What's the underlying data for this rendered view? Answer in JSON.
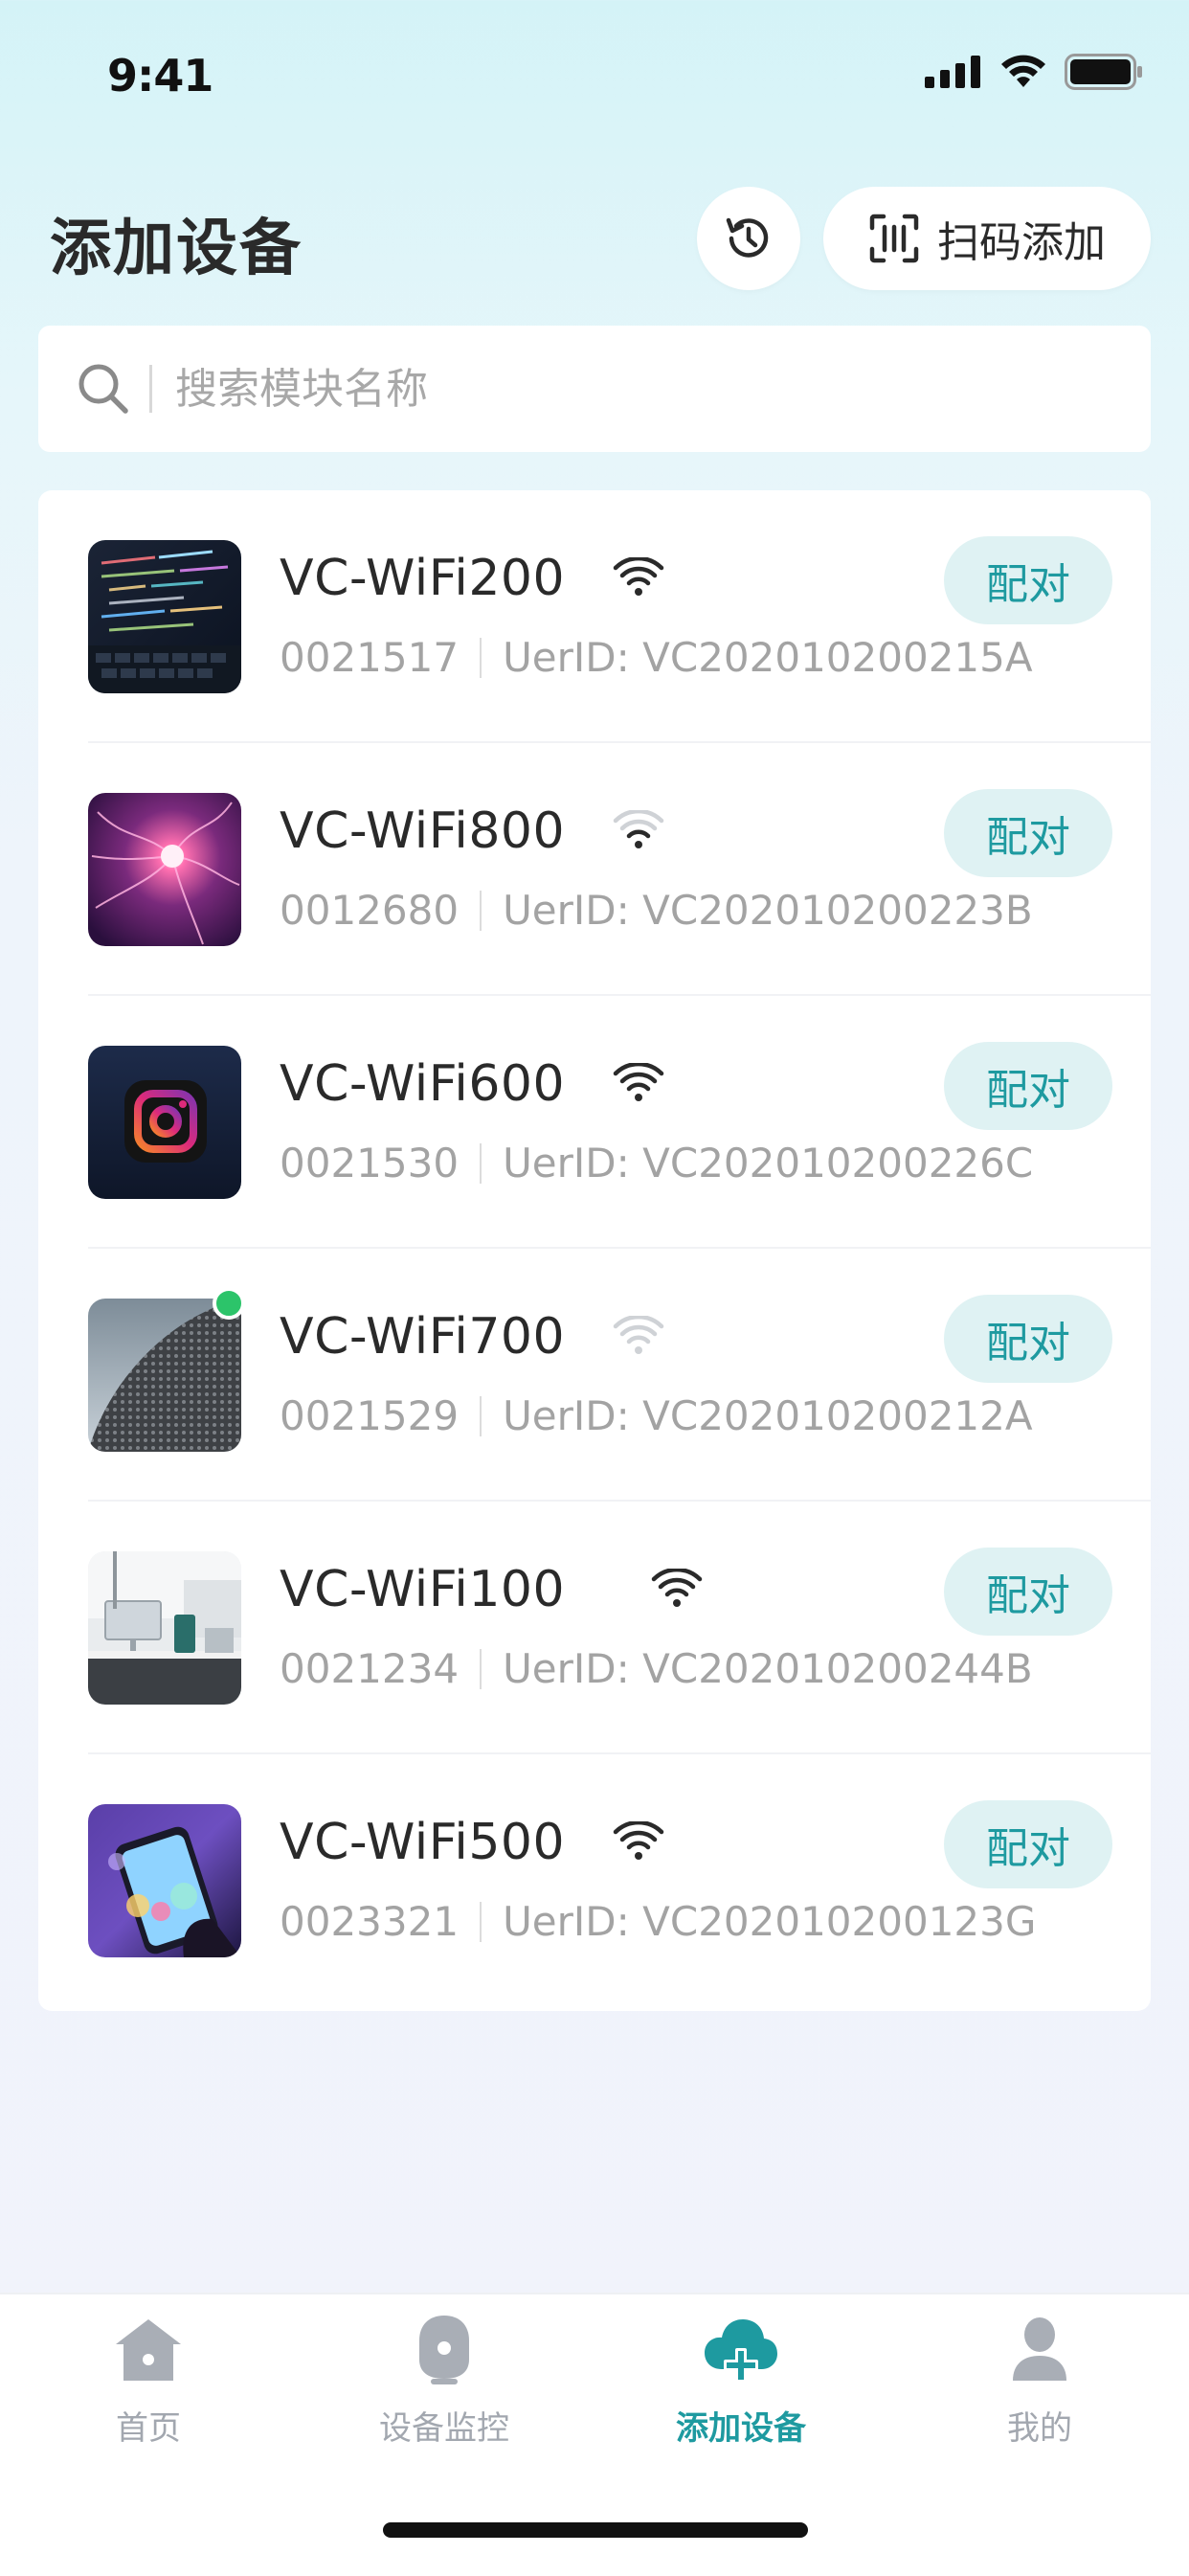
{
  "status_bar": {
    "time": "9:41"
  },
  "header": {
    "title": "添加设备",
    "scan_label": "扫码添加",
    "history_icon": "history-clock-icon",
    "scan_icon": "scan-qr-icon"
  },
  "search": {
    "placeholder": "搜索模块名称",
    "value": ""
  },
  "devices": [
    {
      "name": "VC-WiFi200",
      "code": "0021517",
      "uid": "UerID: VC202010200215A",
      "pair_label": "配对",
      "signal": "strong",
      "online": false
    },
    {
      "name": "VC-WiFi800",
      "code": "0012680",
      "uid": "UerID: VC202010200223B",
      "pair_label": "配对",
      "signal": "weak",
      "online": false
    },
    {
      "name": "VC-WiFi600",
      "code": "0021530",
      "uid": "UerID: VC202010200226C",
      "pair_label": "配对",
      "signal": "strong",
      "online": false
    },
    {
      "name": "VC-WiFi700",
      "code": "0021529",
      "uid": "UerID: VC202010200212A",
      "pair_label": "配对",
      "signal": "none",
      "online": true
    },
    {
      "name": "VC-WiFi100",
      "code": "0021234",
      "uid": "UerID: VC202010200244B",
      "pair_label": "配对",
      "signal": "strong",
      "online": false
    },
    {
      "name": "VC-WiFi500",
      "code": "0023321",
      "uid": "UerID: VC202010200123G",
      "pair_label": "配对",
      "signal": "strong",
      "online": false
    }
  ],
  "tabs": [
    {
      "label": "首页",
      "icon": "home-icon",
      "active": false
    },
    {
      "label": "设备监控",
      "icon": "camera-icon",
      "active": false
    },
    {
      "label": "添加设备",
      "icon": "cloud-add-icon",
      "active": true
    },
    {
      "label": "我的",
      "icon": "user-icon",
      "active": false
    }
  ],
  "colors": {
    "accent": "#1e9aa0",
    "pair_bg": "#dff2f3",
    "online": "#2cc46a",
    "inactive_tab": "#a2a7af"
  }
}
